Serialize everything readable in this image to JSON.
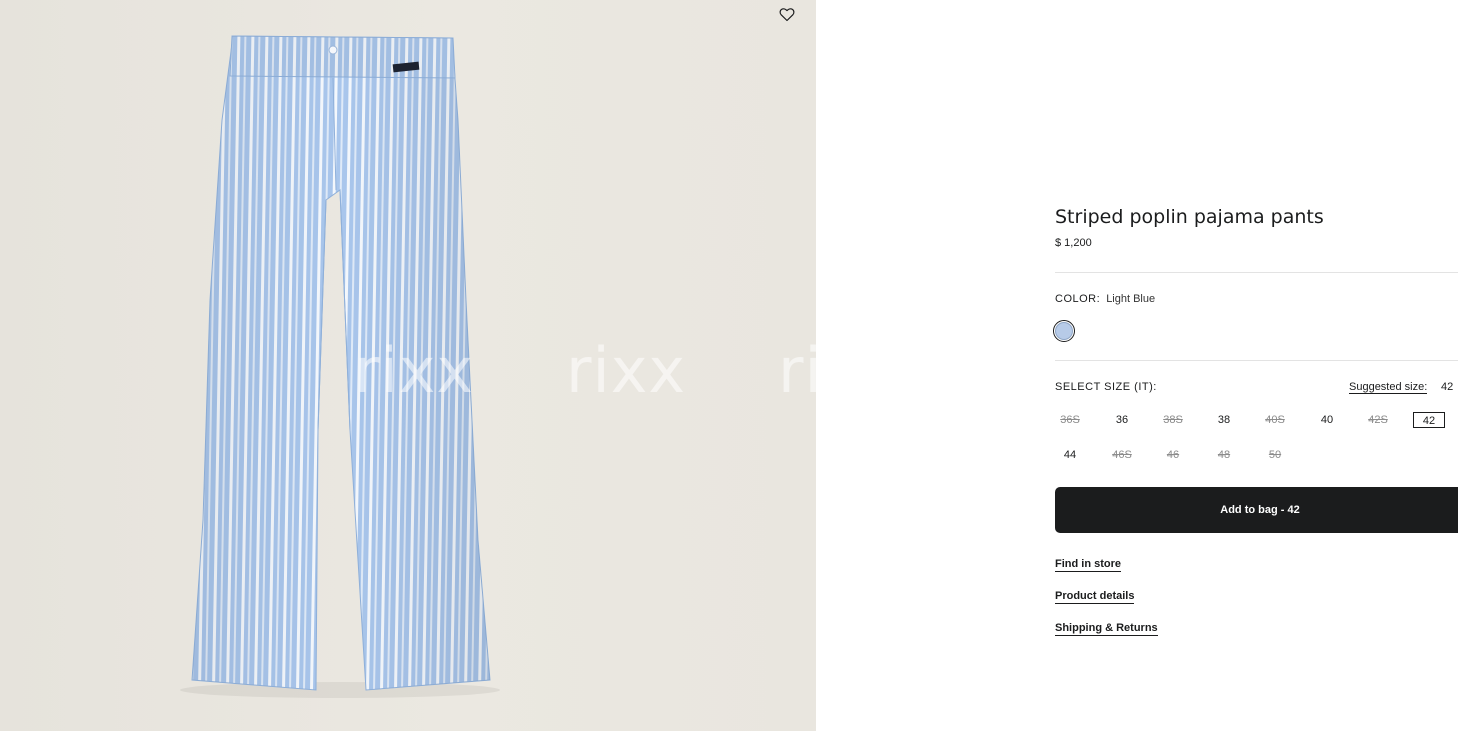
{
  "product": {
    "title": "Striped poplin pajama pants",
    "price": "$ 1,200",
    "color_label": "COLOR:",
    "color_value": "Light Blue",
    "swatch_color": "#b7cbe8"
  },
  "image": {
    "watermark": "rixx",
    "background": "#e9e6df",
    "fabric_stripe_colors": [
      "#9fbfe8",
      "#ffffff"
    ]
  },
  "sizes": {
    "label": "SELECT SIZE (IT):",
    "suggested_label": "Suggested size:",
    "suggested_value": "42",
    "options": [
      {
        "label": "36S",
        "available": false,
        "selected": false
      },
      {
        "label": "36",
        "available": true,
        "selected": false
      },
      {
        "label": "38S",
        "available": false,
        "selected": false
      },
      {
        "label": "38",
        "available": true,
        "selected": false
      },
      {
        "label": "40S",
        "available": false,
        "selected": false
      },
      {
        "label": "40",
        "available": true,
        "selected": false
      },
      {
        "label": "42S",
        "available": false,
        "selected": false
      },
      {
        "label": "42",
        "available": true,
        "selected": true
      },
      {
        "label": "44",
        "available": true,
        "selected": false
      },
      {
        "label": "46S",
        "available": false,
        "selected": false
      },
      {
        "label": "46",
        "available": false,
        "selected": false
      },
      {
        "label": "48",
        "available": false,
        "selected": false
      },
      {
        "label": "50",
        "available": false,
        "selected": false
      }
    ]
  },
  "actions": {
    "add_to_bag": "Add to bag - 42",
    "find_in_store": "Find in store",
    "product_details": "Product details",
    "shipping_returns": "Shipping & Returns"
  },
  "icons": {
    "wishlist": "heart-icon"
  }
}
